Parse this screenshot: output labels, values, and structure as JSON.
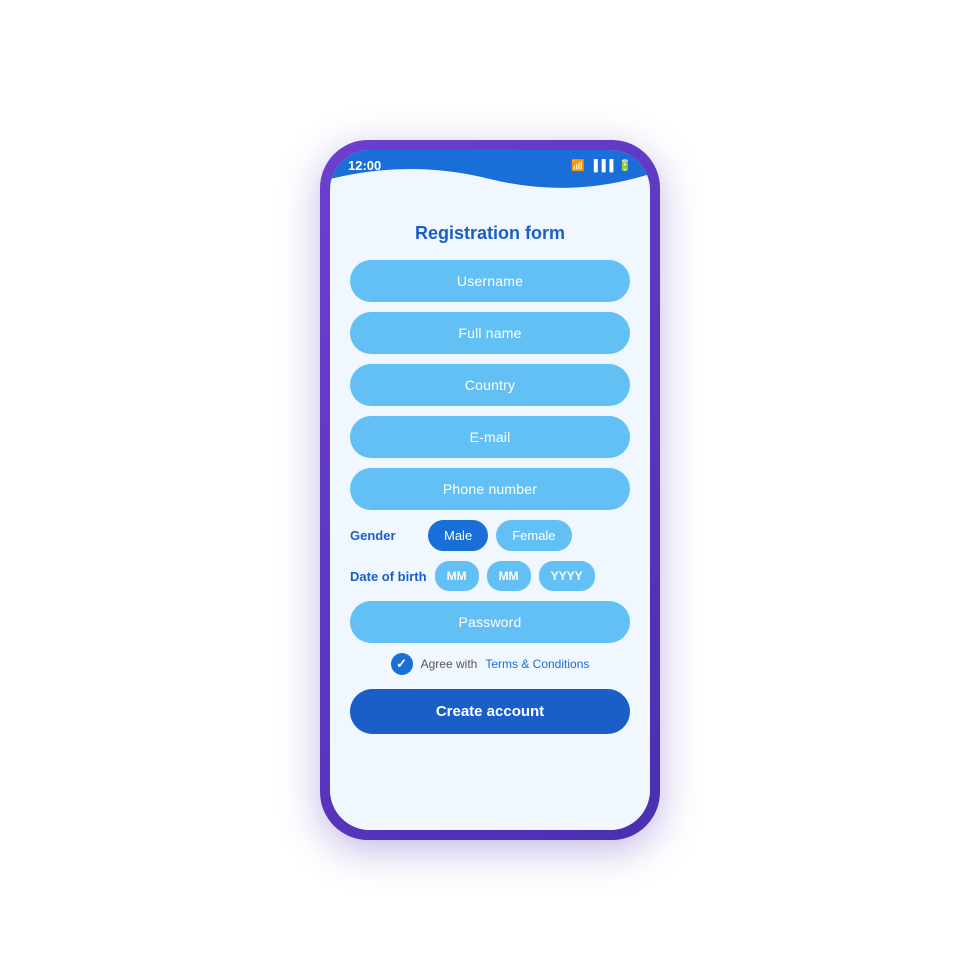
{
  "statusBar": {
    "time": "12:00",
    "wifiIcon": "wifi-icon",
    "signalIcon": "signal-icon",
    "batteryIcon": "battery-icon"
  },
  "header": {
    "title": "Registration form"
  },
  "form": {
    "fields": [
      {
        "id": "username",
        "label": "Username"
      },
      {
        "id": "fullname",
        "label": "Full name"
      },
      {
        "id": "country",
        "label": "Country"
      },
      {
        "id": "email",
        "label": "E-mail"
      },
      {
        "id": "phone",
        "label": "Phone number"
      },
      {
        "id": "password",
        "label": "Password"
      }
    ],
    "gender": {
      "label": "Gender",
      "options": [
        {
          "id": "male",
          "label": "Male",
          "active": true
        },
        {
          "id": "female",
          "label": "Female",
          "active": false
        }
      ]
    },
    "dob": {
      "label": "Date of birth",
      "fields": [
        {
          "id": "month1",
          "placeholder": "MM"
        },
        {
          "id": "month2",
          "placeholder": "MM"
        },
        {
          "id": "year",
          "placeholder": "YYYY"
        }
      ]
    },
    "terms": {
      "text": "Agree with ",
      "linkText": "Terms & Conditions",
      "checked": true
    },
    "submitButton": "Create account"
  }
}
